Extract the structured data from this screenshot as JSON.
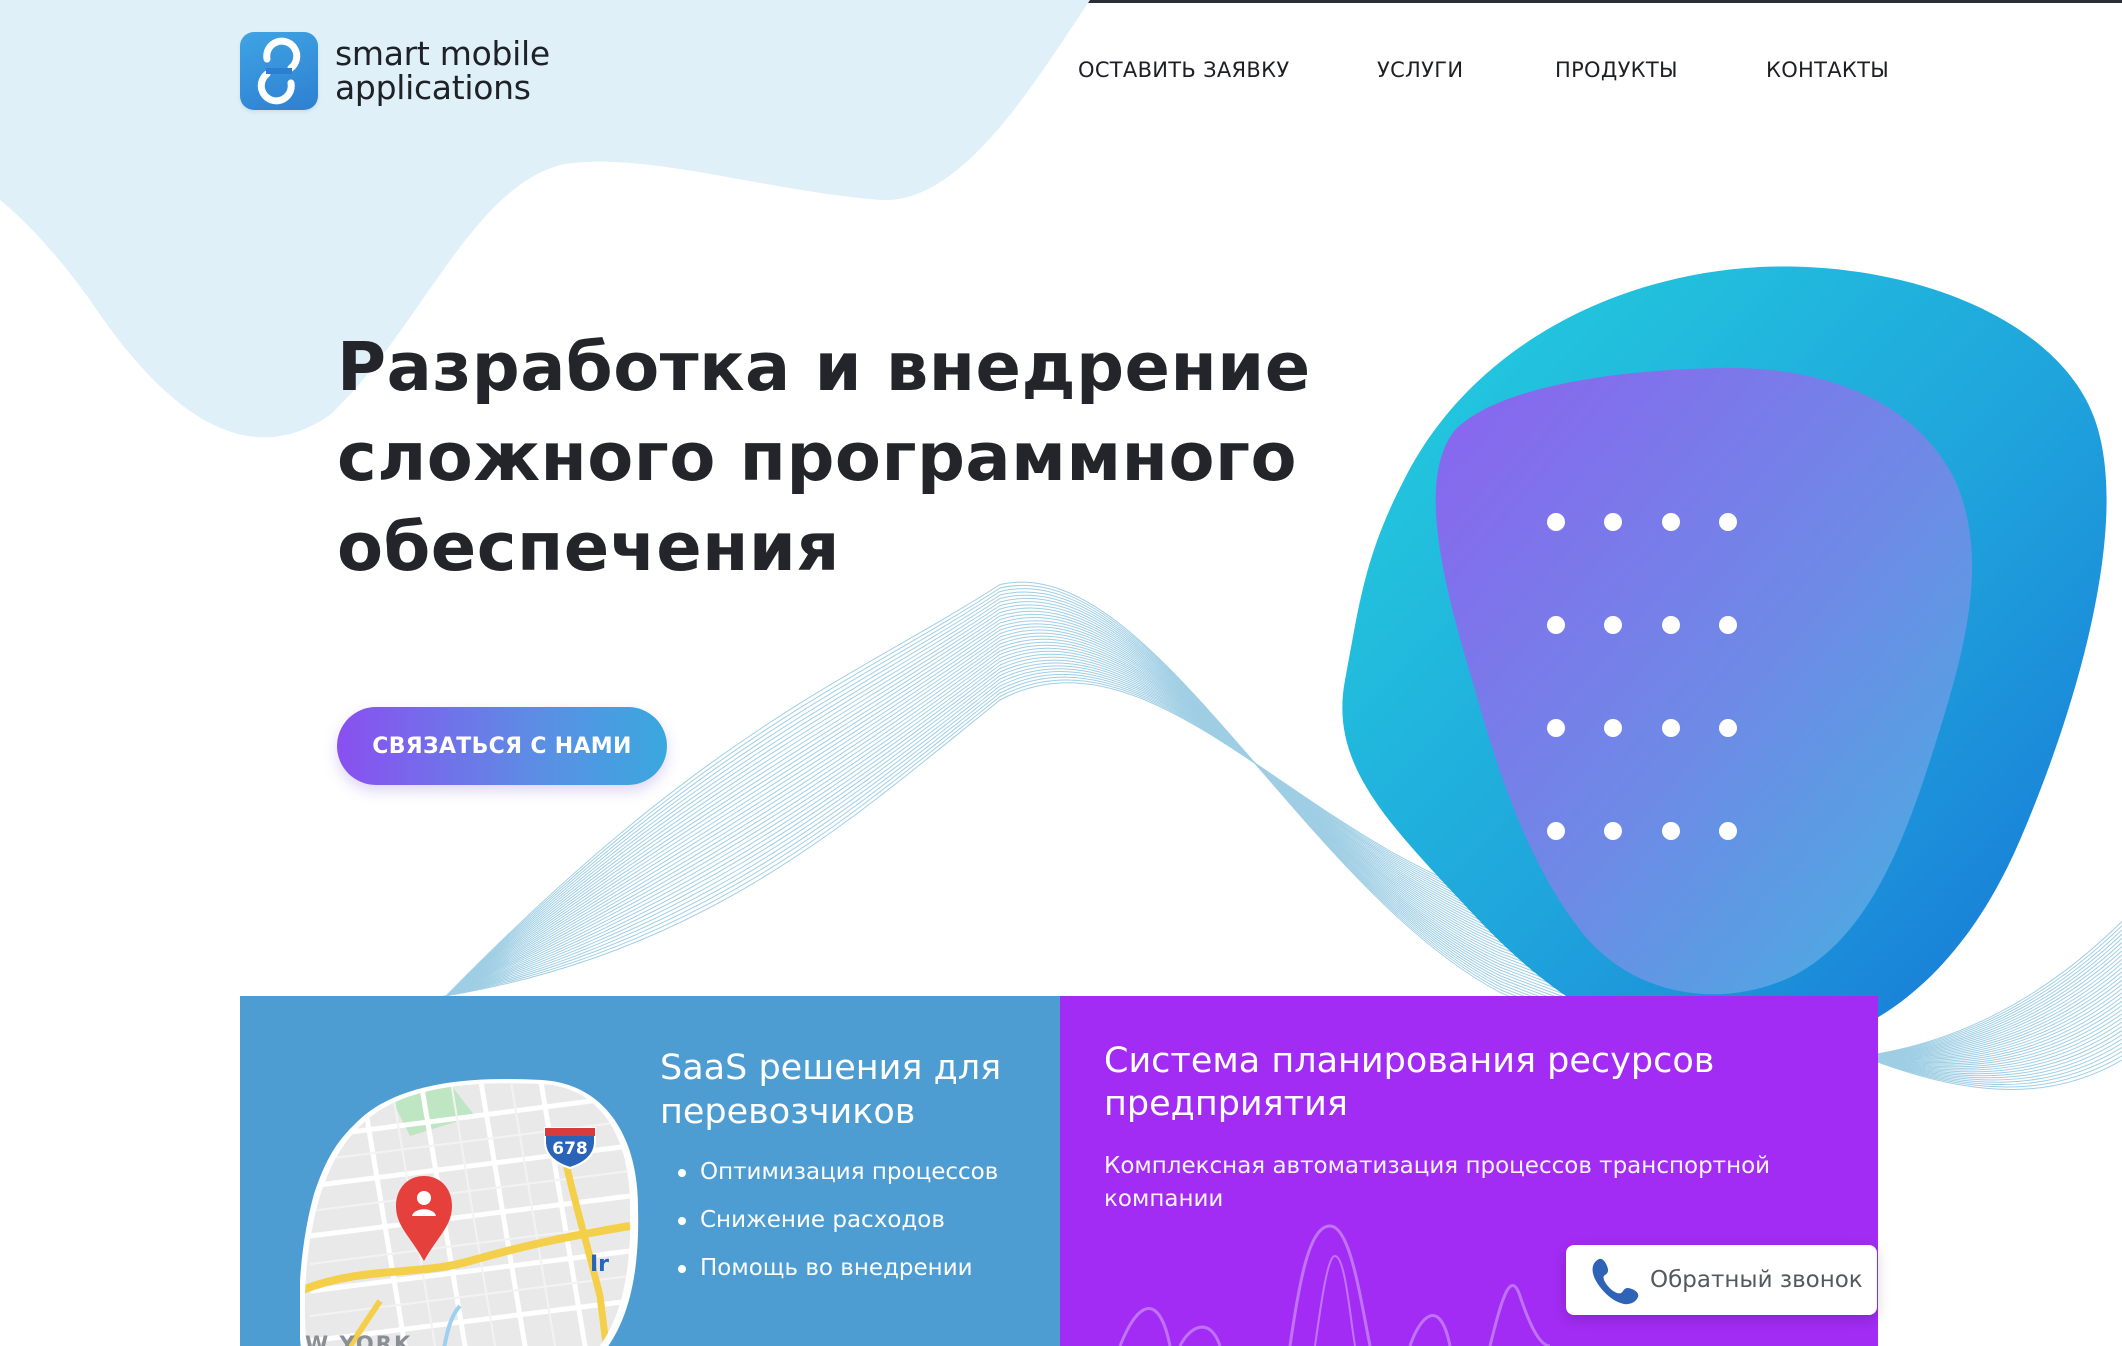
{
  "brand": {
    "name_line1": "smart mobile",
    "name_line2": "applications",
    "icon": "smart-mobile-applications-logo"
  },
  "nav": {
    "items": [
      {
        "label": "ОСТАВИТЬ ЗАЯВКУ"
      },
      {
        "label": "УСЛУГИ"
      },
      {
        "label": "ПРОДУКТЫ"
      },
      {
        "label": "КОНТАКТЫ"
      }
    ]
  },
  "hero": {
    "title_lines": [
      "Разработка и внедрение",
      "сложного программного",
      "обеспечения"
    ],
    "cta_label": "СВЯЗАТЬСЯ С НАМИ"
  },
  "cards": {
    "saas": {
      "title_line1": "SaaS решения для",
      "title_line2": "перевозчиков",
      "bullets": [
        "Оптимизация процессов",
        "Снижение расходов",
        "Помощь во внедрении"
      ],
      "map_highway_label": "678",
      "map_place_label": "W YORK",
      "map_route_label": "Ir"
    },
    "erp": {
      "title_line1": "Система планирования ресурсов",
      "title_line2": "предприятия",
      "description": "Комплексная автоматизация процессов транспортной компании"
    }
  },
  "callback_widget": {
    "label": "Обратный звонок",
    "icon": "phone-icon"
  },
  "colors": {
    "accent_purple": "#a32cf4",
    "card_blue": "#4d9dd3",
    "blob_cyan": "#23c3de",
    "blob_violet": "#8a5ef0",
    "text_dark": "#23252b"
  }
}
